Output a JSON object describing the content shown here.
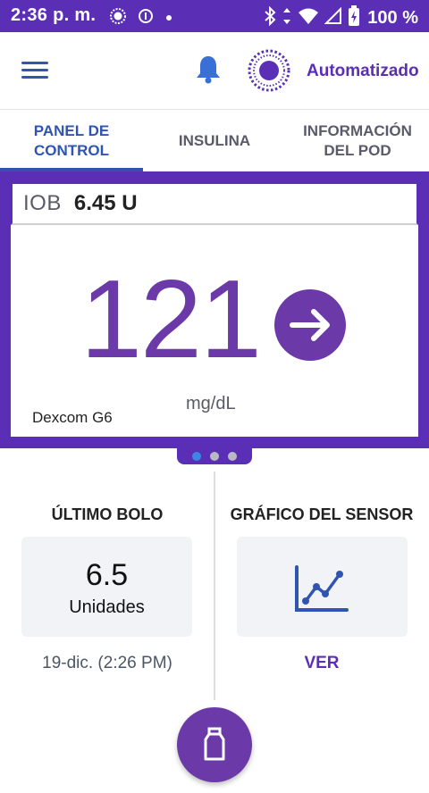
{
  "status_bar": {
    "time": "2:36 p. m.",
    "battery_percent": "100 %",
    "icons": [
      "brightness-icon",
      "data-saver-icon",
      "dot-icon",
      "bluetooth-icon",
      "data-arrows-icon",
      "wifi-icon",
      "cellular-signal-icon",
      "battery-charging-icon"
    ]
  },
  "app_bar": {
    "menu_icon": "hamburger-menu-icon",
    "notification_icon": "bell-icon",
    "mode_icon": "automated-mode-icon",
    "mode_label": "Automatizado"
  },
  "tabs": [
    {
      "label": "PANEL DE\nCONTROL",
      "active": true
    },
    {
      "label": "INSULINA",
      "active": false
    },
    {
      "label": "INFORMACIÓN\nDEL POD",
      "active": false
    }
  ],
  "dashboard": {
    "iob_label": "IOB",
    "iob_value": "6.45 U",
    "glucose_value": "121",
    "glucose_units": "mg/dL",
    "trend_icon": "arrow-right-icon",
    "sensor_name": "Dexcom G6",
    "page_dots": 3,
    "active_dot": 0
  },
  "last_bolus": {
    "title": "ÚLTIMO BOLO",
    "value": "6.5",
    "unit": "Unidades",
    "date": "19-dic. (2:26 PM)"
  },
  "sensor_graph": {
    "title": "GRÁFICO DEL SENSOR",
    "icon": "line-chart-icon",
    "link_label": "VER"
  },
  "fab": {
    "icon": "insulin-vial-icon"
  },
  "colors": {
    "brand_purple": "#5b2fb5",
    "glucose_purple": "#6b3aa8",
    "active_tab_blue": "#2f55b0",
    "dot_active_blue": "#3d86e6"
  }
}
